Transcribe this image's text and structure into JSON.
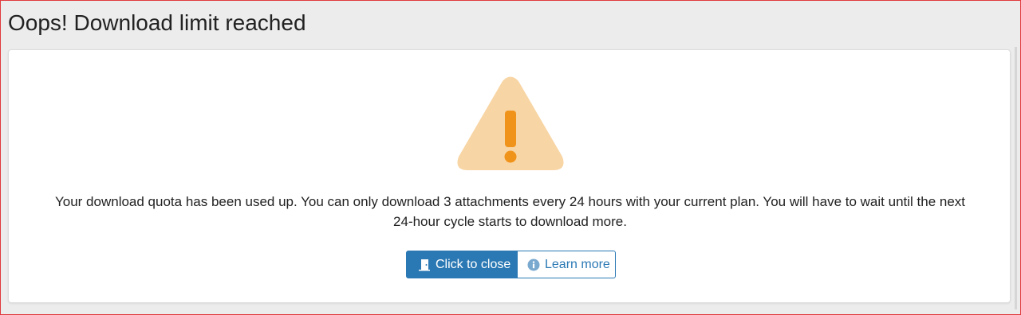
{
  "dialog": {
    "title": "Oops! Download limit reached",
    "message": {
      "line1": "Your download quota has been used up. You can only download 3 attachments every 24 hours with your current plan. You will have to wait until the next",
      "line2": "24-hour cycle starts to download more."
    },
    "icon": "warning-triangle-icon",
    "buttons": {
      "close": {
        "label": "Click to close",
        "icon": "door-icon"
      },
      "learn_more": {
        "label": "Learn more",
        "icon": "info-icon"
      }
    }
  },
  "colors": {
    "accent": "#2b79b4",
    "warning_fill": "#f8d5a4",
    "warning_mark": "#f0931b",
    "background": "#ececec",
    "frame_border": "#e0393e"
  }
}
